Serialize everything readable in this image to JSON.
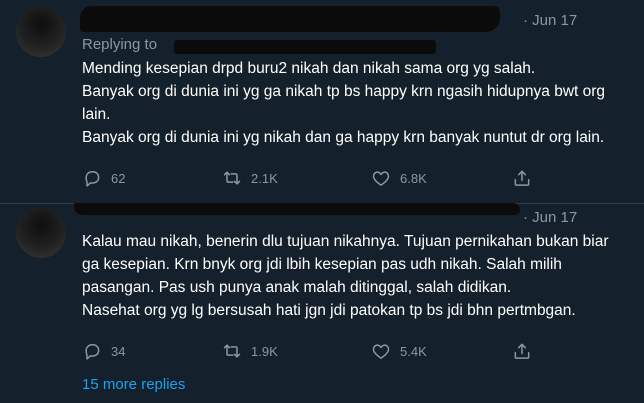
{
  "tweets": [
    {
      "date": "Jun 17",
      "replying_label": "Replying to",
      "lines": [
        "Mending kesepian drpd buru2 nikah dan nikah sama org yg salah.",
        "Banyak org di dunia ini yg ga nikah tp bs happy krn ngasih hidupnya bwt org lain.",
        "Banyak org di dunia ini yg nikah dan ga happy krn banyak nuntut dr org lain."
      ],
      "reply_count": "62",
      "retweet_count": "2.1K",
      "like_count": "6.8K"
    },
    {
      "date": "Jun 17",
      "lines": [
        "Kalau mau nikah, benerin dlu tujuan nikahnya. Tujuan pernikahan bukan biar ga kesepian. Krn bnyk org jdi lbih kesepian pas udh nikah. Salah milih pasangan. Pas ush punya anak malah ditinggal, salah didikan.",
        "Nasehat org yg lg bersusah hati jgn jdi patokan tp bs jdi bhn pertmbgan."
      ],
      "reply_count": "34",
      "retweet_count": "1.9K",
      "like_count": "5.4K"
    }
  ],
  "more_replies_label": "15 more replies",
  "icons": [
    "reply-icon",
    "retweet-icon",
    "like-icon",
    "share-icon"
  ],
  "colors": {
    "background": "#14202b",
    "muted": "#8899a6",
    "link": "#1da1f2",
    "text": "#ffffff"
  }
}
